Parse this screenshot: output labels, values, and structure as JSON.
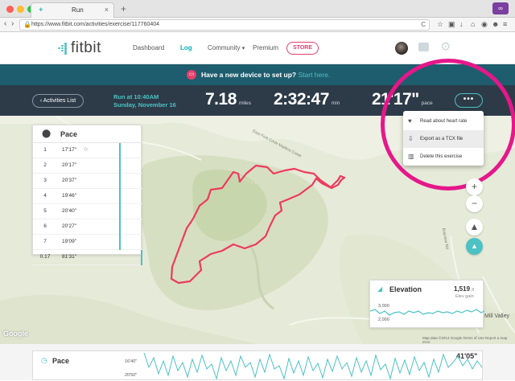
{
  "browser": {
    "tab_title": "Run",
    "tab_close": "×",
    "new_tab": "+",
    "url": "https://www.fitbit.com/activities/exercise/117760404",
    "back": "‹",
    "forward": "›",
    "reload": "C",
    "toolbar_icons": [
      "star-icon",
      "clipboard-icon",
      "download-icon",
      "home-icon",
      "reader-icon",
      "smiley-icon",
      "menu-icon"
    ]
  },
  "nav": {
    "logo": "fitbit",
    "dashboard": "Dashboard",
    "log": "Log",
    "community": "Community",
    "premium": "Premium",
    "store": "STORE"
  },
  "banner": {
    "text": "Have a new device to set up?",
    "link": "Start here."
  },
  "exercise": {
    "back_label": "Activities List",
    "title_line1": "Run at 10:40AM",
    "title_line2": "Sunday, November 16",
    "distance": "7.18",
    "distance_unit": "miles",
    "duration": "2:32:47",
    "duration_unit": "min",
    "pace": "21'17\"",
    "pace_unit": "pace",
    "more": "•••"
  },
  "pace_panel": {
    "title": "Pace",
    "rows": [
      {
        "n": "1",
        "t": "17'17\"",
        "bar": 0.55
      },
      {
        "n": "2",
        "t": "20'17\"",
        "bar": 0.55
      },
      {
        "n": "3",
        "t": "20'37\"",
        "bar": 0.55
      },
      {
        "n": "4",
        "t": "19'46\"",
        "bar": 0.55
      },
      {
        "n": "5",
        "t": "20'40\"",
        "bar": 0.55
      },
      {
        "n": "6",
        "t": "20'27\"",
        "bar": 0.55
      },
      {
        "n": "7",
        "t": "19'09\"",
        "bar": 0.55
      },
      {
        "n": "0.17",
        "t": "81'31\"",
        "bar": 1.0
      }
    ]
  },
  "menu": {
    "items": [
      {
        "label": "Read about heart rate",
        "icon": "heart-icon"
      },
      {
        "label": "Export as a TCX file",
        "icon": "export-icon"
      },
      {
        "label": "Delete this exercise",
        "icon": "trash-icon"
      }
    ]
  },
  "map": {
    "label_top": "East Fork Corte Madera Creek",
    "label_right": "Bayview Rd",
    "label_city": "Mill Valley",
    "google": "Google",
    "terms": "Map data ©2014 Google   Terms of Use   Report a map error"
  },
  "map_controls": {
    "zoom_in": "+",
    "zoom_out": "−"
  },
  "elevation": {
    "title": "Elevation",
    "value": "1,519",
    "value_unit": "ft",
    "gain_label": "Elev gain",
    "ticks": [
      "3,000",
      "2,000"
    ]
  },
  "pace_chart": {
    "title": "Pace",
    "ticks": [
      "16'40\"",
      "20'50\""
    ],
    "value": "41'05\""
  },
  "colors": {
    "teal": "#4cc2c4",
    "pink": "#e83e6c",
    "annotation": "#e6178a",
    "header_dark": "#2d3b48",
    "banner": "#1e5d6e",
    "route": "#ee3a5e"
  }
}
